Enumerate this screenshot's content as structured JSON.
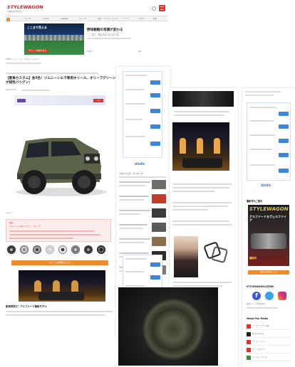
{
  "logo": {
    "line1": "STYLEWAGON",
    "line2": "スタイルワゴン"
  },
  "nav": {
    "items": [
      "ニュース",
      "カスタム",
      "新車情報",
      "ホイール",
      "試乗・インプレッション",
      "パーツ",
      "アフター",
      "特集"
    ]
  },
  "ad_top": {
    "title": "野球観戦の常識が変わる",
    "desc": "ここまで、見えるようになった。",
    "footer": "DAZN",
    "close": "開く",
    "photo_caption": "ここまで見える",
    "badge": "チケット情報を見る"
  },
  "breadcrumb": "HOME > ニュース > スズキ > ジムニー",
  "article": {
    "title": "【愛車カスタム】金5色！ジムニーシエラ専用ホイール、オリーブグリーンが相性バツグン！",
    "date": "2022.03.15",
    "banner": "ad",
    "caption": "ジムニー",
    "note_title": "関連",
    "note_body": "ジムニーにも似合うカラー、ホイール"
  },
  "wheels_cta": "ホイールの詳細はこちら",
  "section_head": "新車発表だ！アルファード最新モデル",
  "sidebar": {
    "ranking_title": "スタイワゴン ランキング",
    "box_btn": "詳細",
    "dodo": "dodo"
  },
  "right_column": {
    "issue_title": "最新号のご案内",
    "mag_title": "STYLEWAGON",
    "mag_sub": "アルファード＆ヴェルファイア",
    "mag_badge": "最新号",
    "buy_btn": "最新号の詳細はこちら",
    "social_title": "STYLEWAGON公式SNS",
    "social_text": "最新ニュースを配信中",
    "media_title": "Motor-Fan Media",
    "media_items": [
      "モーターファン別冊",
      "Motor-Fan.jp",
      "ゲーム・アニメ",
      "オートスポーツ",
      "アイテム・グッズ"
    ]
  },
  "colors": {
    "accent": "#f08a2e",
    "blue": "#3b86d8",
    "red": "#e0352b",
    "green_car": "#5b6449"
  }
}
